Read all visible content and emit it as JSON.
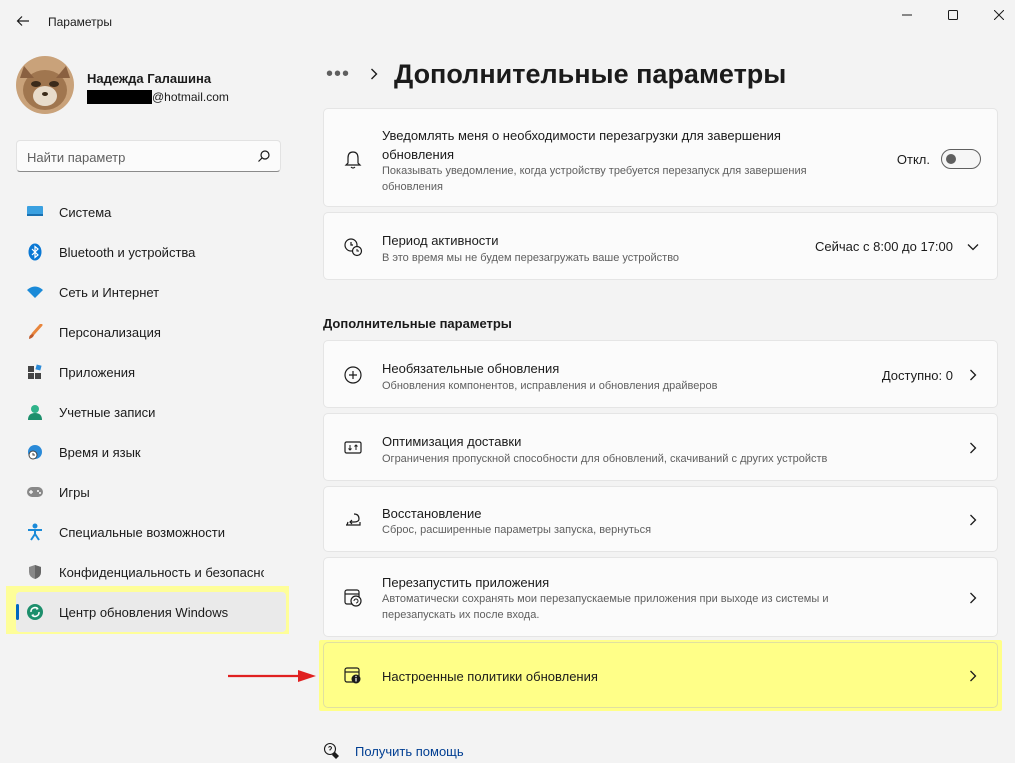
{
  "window": {
    "title": "Параметры"
  },
  "user": {
    "name": "Надежда Галашина",
    "email_suffix": "@hotmail.com"
  },
  "search": {
    "placeholder": "Найти параметр"
  },
  "nav": [
    {
      "label": "Система",
      "icon": "system-icon"
    },
    {
      "label": "Bluetooth и устройства",
      "icon": "bluetooth-icon"
    },
    {
      "label": "Сеть и Интернет",
      "icon": "wifi-icon"
    },
    {
      "label": "Персонализация",
      "icon": "brush-icon"
    },
    {
      "label": "Приложения",
      "icon": "apps-icon"
    },
    {
      "label": "Учетные записи",
      "icon": "account-icon"
    },
    {
      "label": "Время и язык",
      "icon": "globe-clock-icon"
    },
    {
      "label": "Игры",
      "icon": "gamepad-icon"
    },
    {
      "label": "Специальные возможности",
      "icon": "accessibility-icon"
    },
    {
      "label": "Конфиденциальность и безопасность",
      "icon": "shield-icon"
    },
    {
      "label": "Центр обновления Windows",
      "icon": "update-icon",
      "active": true
    }
  ],
  "breadcrumb": {
    "more": "•••",
    "title": "Дополнительные параметры"
  },
  "cards_top": [
    {
      "title": "Уведомлять меня о необходимости перезагрузки для завершения обновления",
      "desc": "Показывать уведомление, когда устройству требуется перезапуск для завершения обновления",
      "value": "Откл.",
      "control": "toggle",
      "toggle_on": false,
      "icon": "bell-icon"
    },
    {
      "title": "Период активности",
      "desc": "В это время мы не будем перезагружать ваше устройство",
      "value": "Сейчас с 8:00 до 17:00",
      "control": "chevron-down",
      "icon": "active-hours-icon"
    }
  ],
  "section_title": "Дополнительные параметры",
  "cards": [
    {
      "title": "Необязательные обновления",
      "desc": "Обновления компонентов, исправления и обновления драйверов",
      "value": "Доступно: 0",
      "icon": "plus-circle-icon"
    },
    {
      "title": "Оптимизация доставки",
      "desc": "Ограничения пропускной способности для обновлений, скачиваний с других устройств",
      "value": "",
      "icon": "delivery-icon"
    },
    {
      "title": "Восстановление",
      "desc": "Сброс, расширенные параметры запуска, вернуться",
      "value": "",
      "icon": "recovery-icon"
    },
    {
      "title": "Перезапустить приложения",
      "desc": "Автоматически сохранять мои перезапускаемые приложения при выходе из системы и перезапускать их после входа.",
      "value": "",
      "icon": "restart-apps-icon"
    },
    {
      "title": "Настроенные политики обновления",
      "desc": "",
      "value": "",
      "icon": "policy-icon"
    }
  ],
  "help": {
    "label": "Получить помощь"
  },
  "colors": {
    "accent": "#0067c0",
    "highlight": "#ffff88",
    "arrow": "#e02020"
  }
}
